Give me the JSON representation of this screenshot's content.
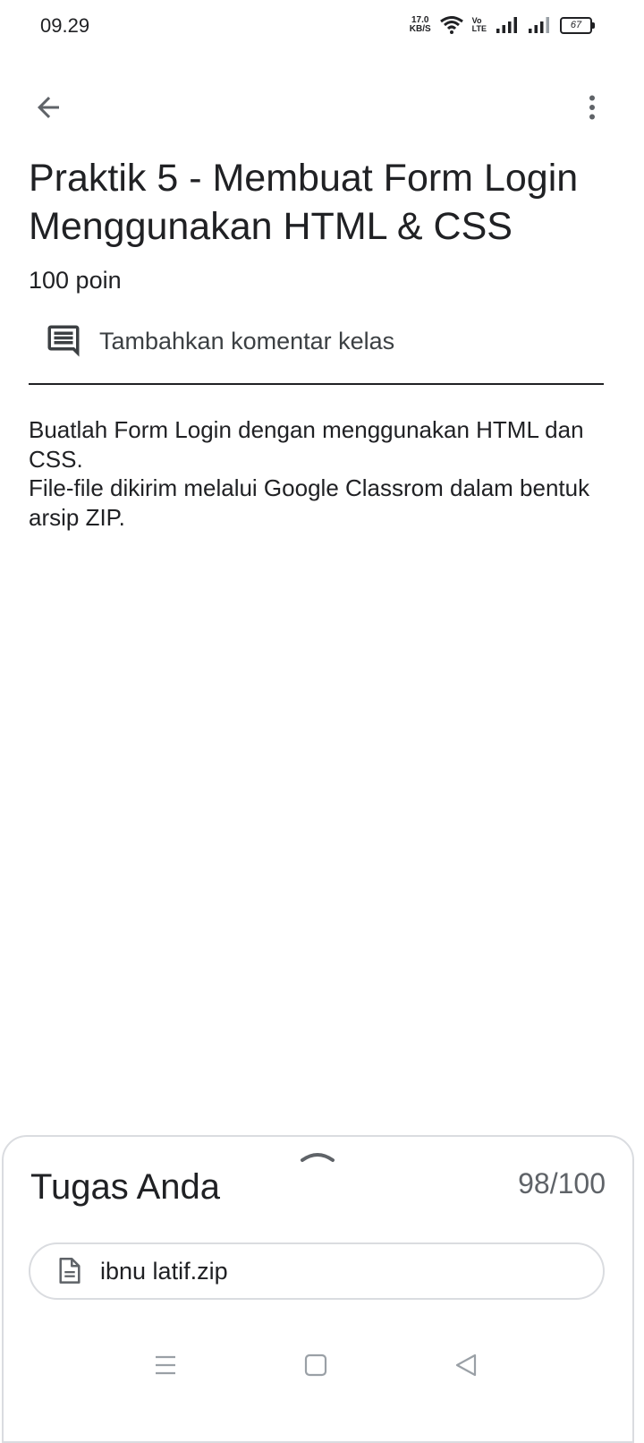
{
  "status_bar": {
    "time": "09.29",
    "net_speed_value": "17.0",
    "net_speed_unit": "KB/S",
    "volte_top": "Vo",
    "volte_bottom": "LTE",
    "battery": "67",
    "icons": [
      "wifi-icon",
      "volte-icon",
      "signal-icon",
      "signal-icon",
      "battery-icon"
    ]
  },
  "app_bar": {
    "back_icon": "arrow-back-icon",
    "more_icon": "more-vert-icon"
  },
  "assignment": {
    "title": "Praktik 5 - Membuat Form Login Menggunakan HTML & CSS",
    "points": "100 poin",
    "comment_icon": "comment-icon",
    "comment_label": "Tambahkan komentar kelas",
    "description": "Buatlah Form Login dengan menggunakan HTML dan CSS.\nFile-file dikirim melalui Google Classrom dalam bentuk arsip ZIP."
  },
  "your_work": {
    "handle_icon": "chevron-up-icon",
    "title": "Tugas Anda",
    "grade": "98/100",
    "attachment": {
      "icon": "file-icon",
      "name": "ibnu latif.zip"
    }
  },
  "nav_bar": {
    "icons": [
      "menu-icon",
      "home-square-icon",
      "back-triangle-icon"
    ]
  },
  "colors": {
    "text": "#202124",
    "secondary_text": "#5f6368",
    "border": "#dadce0",
    "background": "#ffffff"
  }
}
